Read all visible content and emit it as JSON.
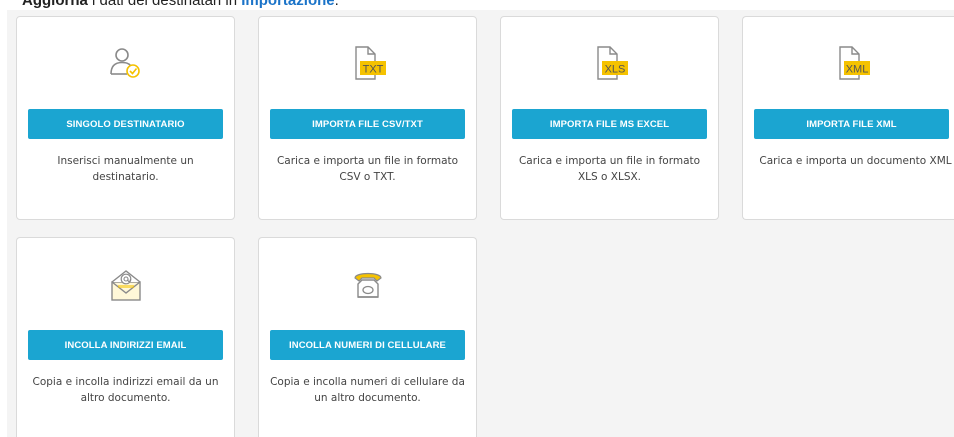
{
  "header": {
    "prefix": "Aggiorna",
    "middle": " i dati dei destinatari in ",
    "link": "Importazione",
    "suffix": "."
  },
  "cards": [
    {
      "icon": "user-check-icon",
      "button": "SINGOLO DESTINATARIO",
      "description": "Inserisci manualmente un destinatario."
    },
    {
      "icon": "txt-file-icon",
      "icon_label": "TXT",
      "button": "IMPORTA FILE CSV/TXT",
      "description": "Carica e importa un file in formato CSV o TXT."
    },
    {
      "icon": "xls-file-icon",
      "icon_label": "XLS",
      "button": "IMPORTA FILE MS EXCEL",
      "description": "Carica e importa un file in formato XLS o XLSX."
    },
    {
      "icon": "xml-file-icon",
      "icon_label": "XML",
      "button": "IMPORTA FILE XML",
      "description": "Carica e importa un documento XML"
    },
    {
      "icon": "email-envelope-icon",
      "button": "INCOLLA INDIRIZZI EMAIL",
      "description": "Copia e incolla indirizzi email da un altro documento."
    },
    {
      "icon": "telephone-icon",
      "button": "INCOLLA NUMERI DI CELLULARE",
      "description": "Copia e incolla numeri di cellulare da un altro documento."
    }
  ],
  "colors": {
    "button": "#1ba5d1",
    "icon_accent": "#f5c200",
    "icon_gray": "#8a8a8a",
    "panel_bg": "#f4f4f4"
  }
}
